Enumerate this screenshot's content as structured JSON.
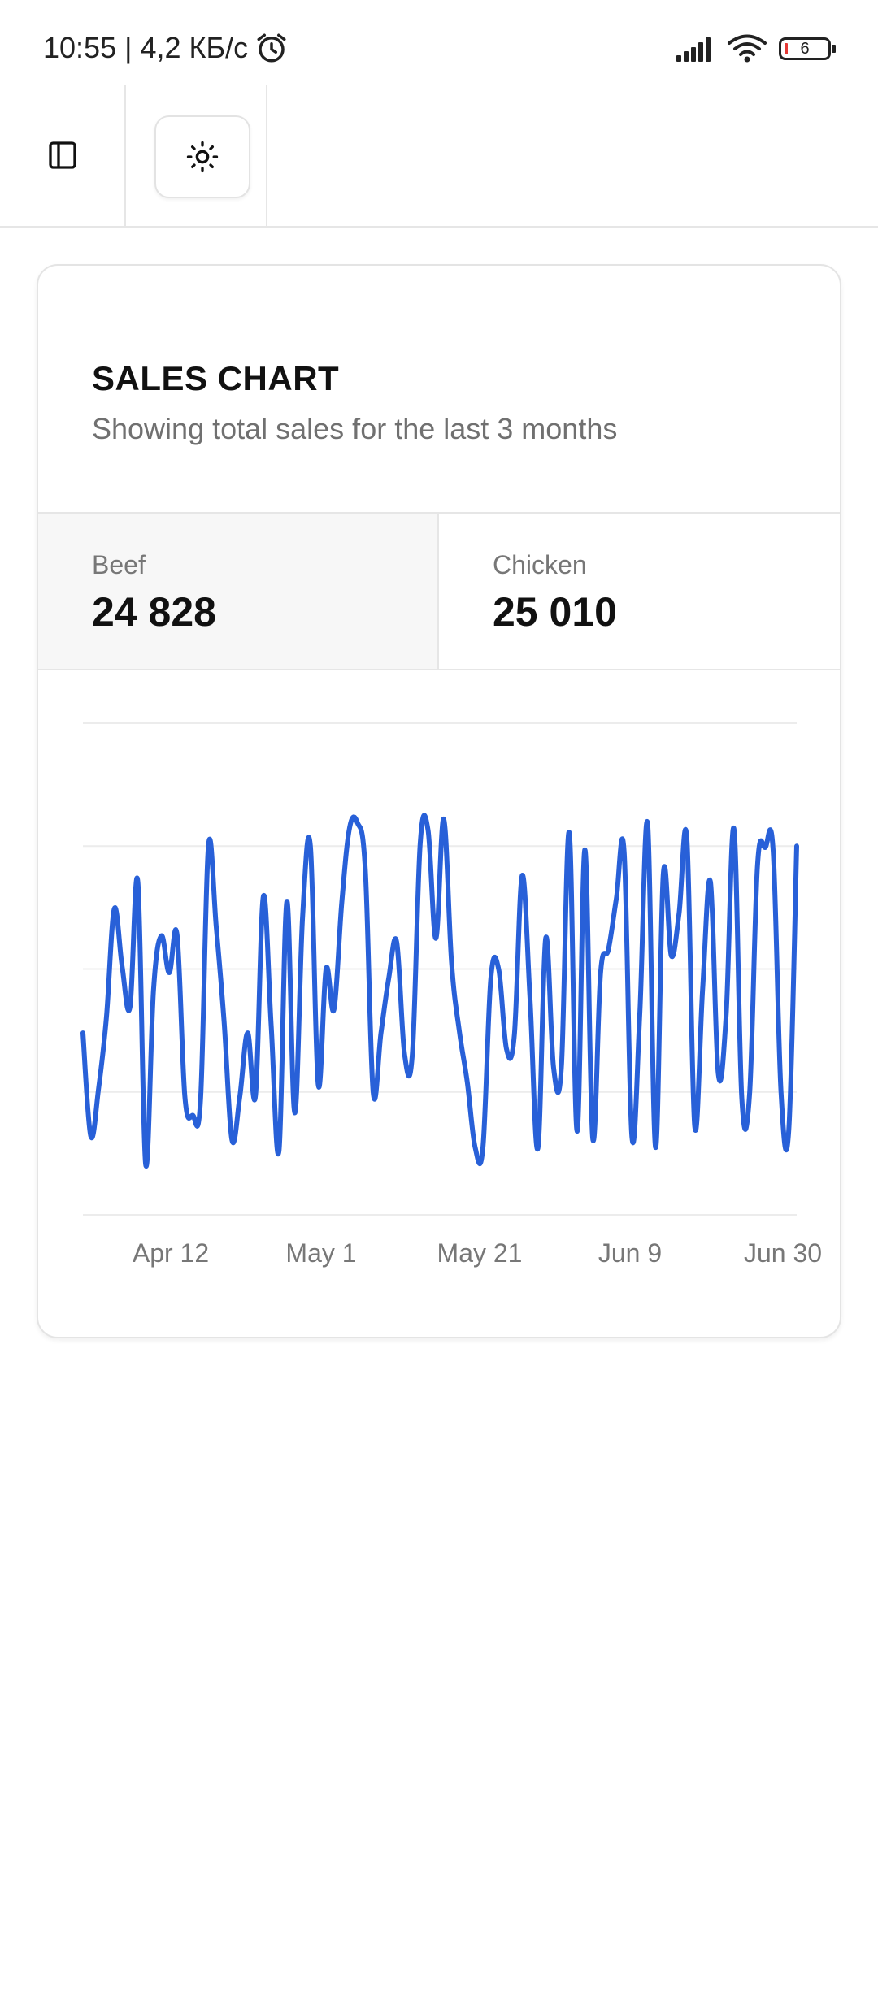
{
  "status_bar": {
    "time_speed": "10:55 | 4,2 КБ/с",
    "battery_level": "6",
    "icons": [
      "alarm-icon",
      "signal-icon",
      "wifi-icon",
      "battery-icon"
    ]
  },
  "toolbar": {
    "sidebar_icon": "sidebar-panel-icon",
    "theme_icon": "sun-icon"
  },
  "card": {
    "title": "SALES CHART",
    "subtitle": "Showing total sales for the last 3 months",
    "stats": [
      {
        "label": "Beef",
        "value": "24 828"
      },
      {
        "label": "Chicken",
        "value": "25 010"
      }
    ]
  },
  "colors": {
    "line": "#2860d8",
    "grid": "#ececec",
    "tick_text": "#777777"
  },
  "chart_data": {
    "type": "line",
    "grid": true,
    "x_ticks": [
      "Apr 12",
      "May 1",
      "May 21",
      "Jun 9",
      "Jun 30"
    ],
    "ylim": [
      0,
      4
    ],
    "series": [
      {
        "values": [
          1.48,
          0.64,
          1.03,
          1.61,
          2.49,
          2.02,
          1.69,
          2.71,
          0.41,
          1.83,
          2.27,
          1.97,
          2.28,
          0.96,
          0.81,
          0.94,
          3.0,
          2.34,
          1.57,
          0.61,
          0.96,
          1.48,
          0.97,
          2.59,
          1.54,
          0.52,
          2.55,
          0.83,
          2.42,
          3.0,
          1.06,
          2.0,
          1.67,
          2.54,
          3.15,
          3.19,
          2.81,
          1.0,
          1.48,
          1.93,
          2.22,
          1.31,
          1.31,
          3.02,
          3.13,
          2.25,
          3.22,
          2.05,
          1.49,
          1.08,
          0.55,
          0.55,
          1.92,
          2.0,
          1.35,
          1.46,
          2.76,
          1.76,
          0.54,
          2.25,
          1.2,
          1.2,
          3.11,
          0.68,
          2.97,
          0.62,
          1.97,
          2.16,
          2.57,
          2.95,
          0.63,
          1.64,
          3.18,
          0.55,
          2.78,
          2.11,
          2.45,
          3.06,
          0.72,
          1.83,
          2.71,
          1.15,
          1.62,
          3.14,
          0.95,
          0.99,
          2.84,
          2.99,
          2.96,
          1.0,
          0.7,
          3.0
        ]
      }
    ]
  }
}
